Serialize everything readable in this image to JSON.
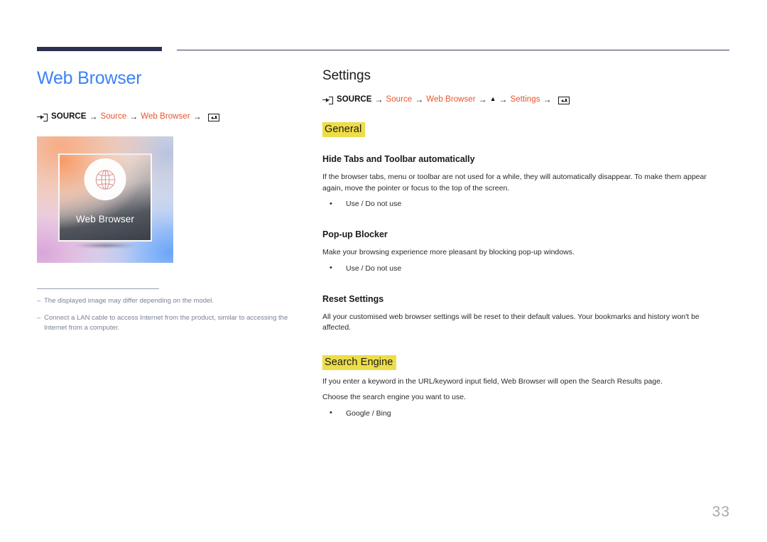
{
  "page": {
    "number": "33"
  },
  "left": {
    "title": "Web Browser",
    "breadcrumb": {
      "source_icon": "source-input-icon",
      "source_label": "SOURCE",
      "arrow": "→",
      "items": [
        "Source",
        "Web Browser"
      ],
      "enter_icon": "enter-key-icon"
    },
    "thumbnail": {
      "label": "Web Browser",
      "icon": "globe-icon"
    },
    "notes": [
      {
        "dash": "–",
        "text": "The displayed image may differ depending on the model."
      },
      {
        "dash": "–",
        "text": "Connect a LAN cable to access Internet from the product, similar to accessing the Internet from a computer."
      }
    ]
  },
  "right": {
    "title": "Settings",
    "breadcrumb": {
      "source_icon": "source-input-icon",
      "source_label": "SOURCE",
      "arrow": "→",
      "item1": "Source",
      "item2": "Web Browser",
      "triangle": "▲",
      "item3": "Settings",
      "enter_icon": "enter-key-icon"
    },
    "sections": [
      {
        "heading": "General",
        "highlight_color": "#eedd4a",
        "subsections": [
          {
            "title": "Hide Tabs and Toolbar automatically",
            "body": "If the browser tabs, menu or toolbar are not used for a while, they will automatically disappear. To make them appear again, move the pointer or focus to the top of the screen.",
            "bullets": [
              "Use / Do not use"
            ]
          },
          {
            "title": "Pop-up Blocker",
            "body": "Make your browsing experience more pleasant by blocking pop-up windows.",
            "bullets": [
              "Use / Do not use"
            ]
          },
          {
            "title": "Reset Settings",
            "body": "All your customised web browser settings will be reset to their default values. Your bookmarks and history won't be affected.",
            "bullets": []
          }
        ]
      },
      {
        "heading": "Search Engine",
        "highlight_color": "#eedd4a",
        "body1": "If you enter a keyword in the URL/keyword input field, Web Browser will open the Search Results page.",
        "body2": "Choose the search engine you want to use.",
        "bullets": [
          "Google / Bing"
        ]
      }
    ]
  },
  "colors": {
    "title_blue": "#3b82f6",
    "accent_orange": "#e8542a",
    "rule_navy": "#2e3050",
    "highlight_yellow": "#eedd4a",
    "note_gray": "#7b8296",
    "page_num_gray": "#a9a9a9"
  }
}
